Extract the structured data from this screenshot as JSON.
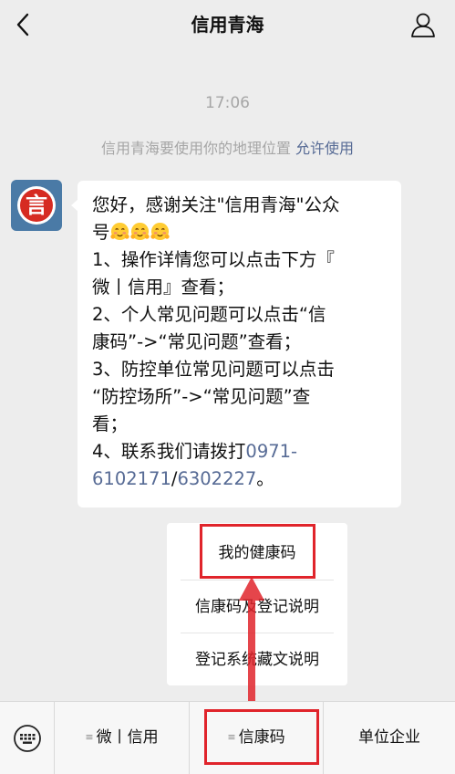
{
  "nav": {
    "back_icon": "chevron-left-icon",
    "title": "信用青海",
    "profile_icon": "person-icon"
  },
  "chat": {
    "timestamp": "17:06",
    "location_tip": "信用青海要使用你的地理位置",
    "location_allow": "允许使用",
    "avatar_glyph": "言",
    "message": {
      "line1": "您好，感谢关注\"信用青海\"公众",
      "line2": "号",
      "line3": "1、操作详情您可以点击下方『",
      "line4": "微丨信用』查看；",
      "line5": "2、个人常见问题可以点击“信",
      "line6": "康码”->“常见问题”查看；",
      "line7": "3、防控单位常见问题可以点击",
      "line8": "“防控场所”->“常见问题”查",
      "line9": "看；",
      "line10_prefix": "4、联系我们请拨打",
      "phone_part1": "0971-",
      "phone_part2": "6102171",
      "phone_sep": "/",
      "phone_part3": "6302227",
      "phone_end": "。",
      "emoji_icon": "blush-emoji-icon"
    }
  },
  "popup_menu": {
    "items": [
      {
        "label": "我的健康码"
      },
      {
        "label": "信康码及登记说明"
      },
      {
        "label": "登记系统藏文说明"
      }
    ]
  },
  "bottom_bar": {
    "keyboard_icon": "keyboard-icon",
    "menu_lines_icon": "≡",
    "tabs": [
      {
        "label": "微丨信用"
      },
      {
        "label": "信康码"
      },
      {
        "label": "单位企业"
      }
    ]
  },
  "colors": {
    "highlight": "#e0242b",
    "link": "#576b95",
    "avatar_bg": "#4a7aa6"
  }
}
